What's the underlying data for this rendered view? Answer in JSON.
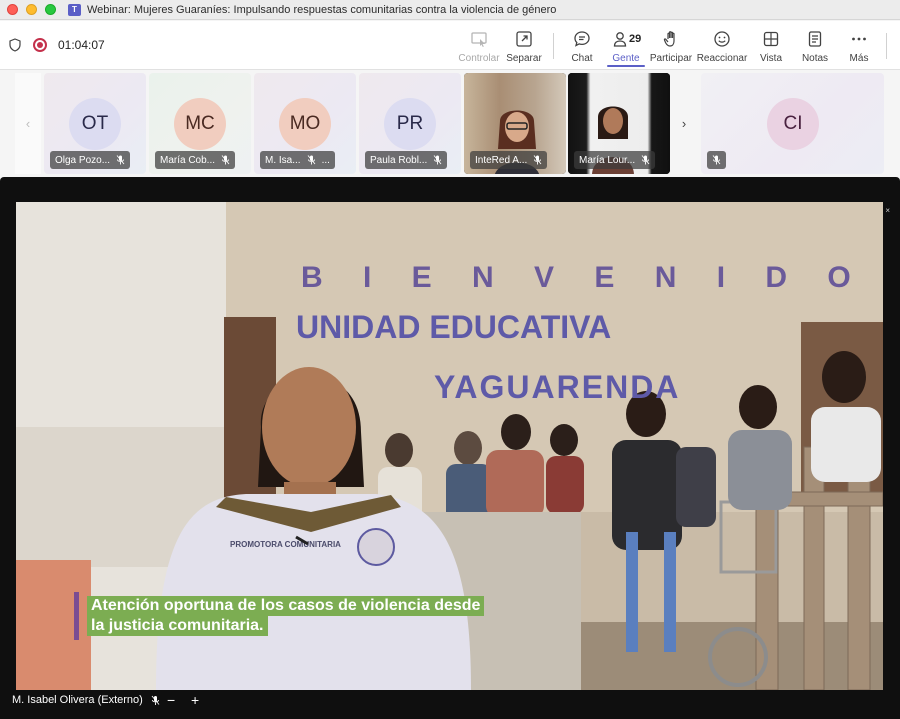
{
  "window": {
    "title": "Webinar: Mujeres Guaraníes: Impulsando respuestas comunitarias contra la violencia de género",
    "app_icon": "teams-icon"
  },
  "toolbar": {
    "timer": "01:04:07",
    "recording": true,
    "people_count": "29",
    "buttons": [
      {
        "name": "controlar",
        "label": "Controlar",
        "icon": "control-icon",
        "enabled": false
      },
      {
        "name": "separar",
        "label": "Separar",
        "icon": "pop-out-icon",
        "enabled": true
      },
      {
        "name": "chat",
        "label": "Chat",
        "icon": "chat-icon",
        "enabled": true
      },
      {
        "name": "gente",
        "label": "Gente",
        "icon": "people-icon",
        "enabled": true,
        "active": true
      },
      {
        "name": "participar",
        "label": "Participar",
        "icon": "raise-hand-icon",
        "enabled": true
      },
      {
        "name": "reaccionar",
        "label": "Reaccionar",
        "icon": "smiley-icon",
        "enabled": true
      },
      {
        "name": "vista",
        "label": "Vista",
        "icon": "grid-view-icon",
        "enabled": true
      },
      {
        "name": "notas",
        "label": "Notas",
        "icon": "notes-icon",
        "enabled": true
      },
      {
        "name": "mas",
        "label": "Más",
        "icon": "more-icon",
        "enabled": true
      }
    ],
    "accent_color": "#5b5fc7"
  },
  "gallery": {
    "participants": [
      {
        "initials": "OT",
        "name": "Olga Pozo...",
        "muted": true,
        "type": "avatar"
      },
      {
        "initials": "MC",
        "name": "María Cob...",
        "muted": true,
        "type": "avatar"
      },
      {
        "initials": "MO",
        "name": "M. Isa...",
        "muted": true,
        "type": "avatar",
        "more": "..."
      },
      {
        "initials": "PR",
        "name": "Paula Robl...",
        "muted": true,
        "type": "avatar"
      },
      {
        "initials": "",
        "name": "InteRed A...",
        "muted": true,
        "type": "video"
      },
      {
        "initials": "",
        "name": "María Lour...",
        "muted": true,
        "type": "video"
      },
      {
        "initials": "CI",
        "name": "",
        "muted": true,
        "type": "avatar"
      }
    ]
  },
  "stage": {
    "speaker_name": "M. Isabel Olivera (Externo)",
    "zoom_out": "−",
    "zoom_in": "+",
    "scene_text": {
      "line1": "B I E N V E N I D O S   A   L A",
      "line2": "UNIDAD EDUCATIVA",
      "line3": "YAGUARENDA"
    },
    "shirt_text": "PROMOTORA COMUNITARIA",
    "caption": {
      "line1": "Atención oportuna de los casos de violencia desde",
      "line2": "la justicia comunitaria."
    }
  }
}
